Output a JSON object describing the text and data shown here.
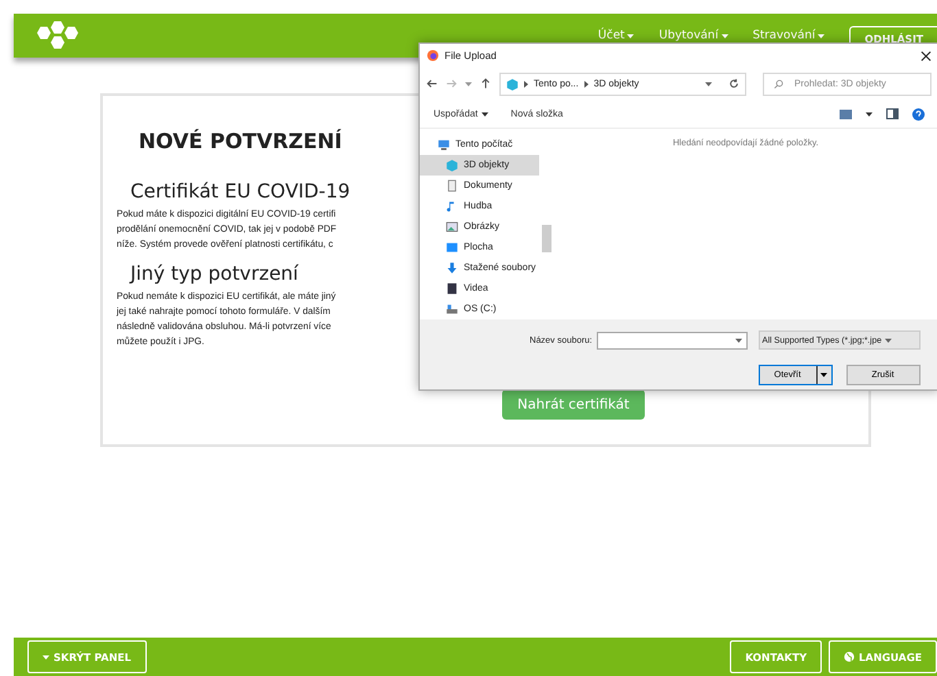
{
  "header": {
    "menu": [
      {
        "label": "Účet"
      },
      {
        "label": "Ubytování"
      },
      {
        "label": "Stravování"
      }
    ],
    "logout": "ODHLÁSIT"
  },
  "card": {
    "title": "NOVÉ POTVRZENÍ",
    "sections": [
      {
        "heading": "Certifikát EU COVID-19",
        "lines": [
          "Pokud máte k dispozici digitální EU COVID-19 certifi",
          "prodělání onemocnění COVID, tak jej v podobě PDF",
          "níže. Systém provede ověření platnosti certifikátu, c"
        ]
      },
      {
        "heading": "Jiný typ potvrzení",
        "lines": [
          "Pokud nemáte k dispozici EU certifikát, ale máte jiný",
          "jej také nahrajte pomocí tohoto formuláře. V dalším",
          "následně validována obsluhou. Má-li potvrzení více",
          "můžete použít i JPG."
        ]
      }
    ],
    "upload_button": "Nahrát certifikát"
  },
  "dialog": {
    "title": "File Upload",
    "path": [
      "Tento po...",
      "3D objekty"
    ],
    "search": {
      "placeholder": "Prohledat: 3D objekty"
    },
    "toolbar": [
      "Uspořádat",
      "Nová složka"
    ],
    "nav": [
      {
        "label": "Tento počítač",
        "selected": false,
        "children": [
          {
            "label": "3D objekty",
            "selected": true
          },
          {
            "label": "Dokumenty",
            "selected": false
          },
          {
            "label": "Hudba",
            "selected": false
          },
          {
            "label": "Obrázky",
            "selected": false
          },
          {
            "label": "Plocha",
            "selected": false
          },
          {
            "label": "Stažené soubory",
            "selected": false
          },
          {
            "label": "Videa",
            "selected": false
          },
          {
            "label": "OS (C:)",
            "selected": false
          }
        ]
      }
    ],
    "empty_message": "Hledání neodpovídají žádné položky.",
    "filename": {
      "label": "Název souboru:"
    },
    "filter": "All Supported Types (*.jpg;*.jpe",
    "open_button": "Otevřít",
    "cancel_button": "Zrušit"
  },
  "footer": {
    "hide_panel": "SKRÝT PANEL",
    "contacts": "KONTAKTY",
    "language": "LANGUAGE"
  }
}
